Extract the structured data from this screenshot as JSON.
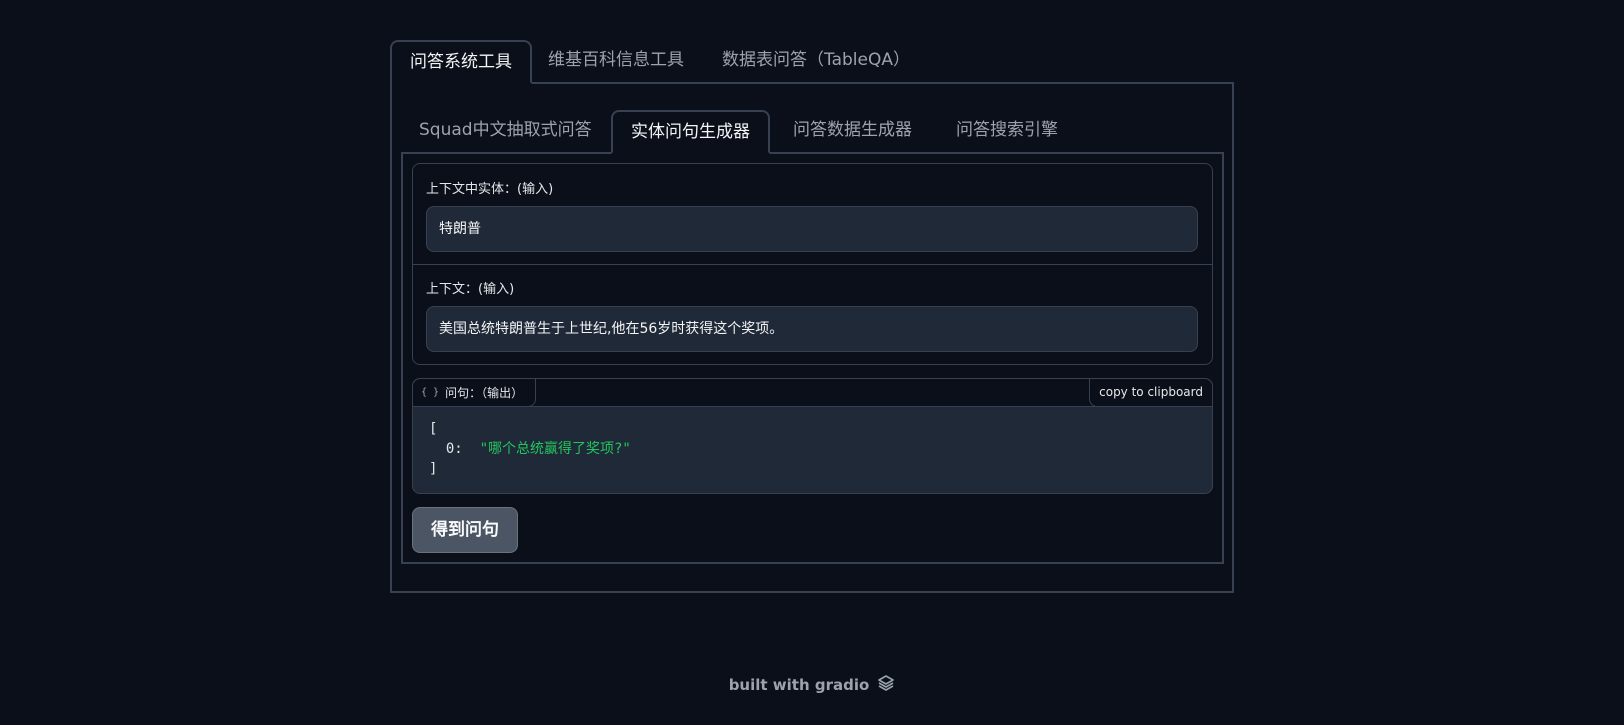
{
  "outer_tabs": [
    {
      "label": "问答系统工具",
      "active": true
    },
    {
      "label": "维基百科信息工具",
      "active": false
    },
    {
      "label": "数据表问答（TableQA）",
      "active": false
    }
  ],
  "inner_tabs": [
    {
      "label": "Squad中文抽取式问答",
      "active": false
    },
    {
      "label": "实体问句生成器",
      "active": true
    },
    {
      "label": "问答数据生成器",
      "active": false
    },
    {
      "label": "问答搜索引擎",
      "active": false
    }
  ],
  "form": {
    "entity_label": "上下文中实体：(输入)",
    "entity_value": "特朗普",
    "context_label": "上下文：(输入)",
    "context_value": "美国总统特朗普生于上世纪,他在56岁时获得这个奖项。"
  },
  "output": {
    "icon": "{ }",
    "label": "问句：（输出）",
    "copy_label": "copy to clipboard",
    "open_bracket": "[",
    "item_index": "0:",
    "item_value": "\"哪个总统赢得了奖项?\"",
    "close_bracket": "]"
  },
  "submit": {
    "label": "得到问句"
  },
  "footer": {
    "text": "built with gradio",
    "icon": "gradio-logo-icon"
  },
  "colors": {
    "background": "#0b0f19",
    "border": "#374151",
    "input_bg": "#1f2937",
    "json_string": "#22c55e",
    "button_bg": "#4b5563"
  }
}
